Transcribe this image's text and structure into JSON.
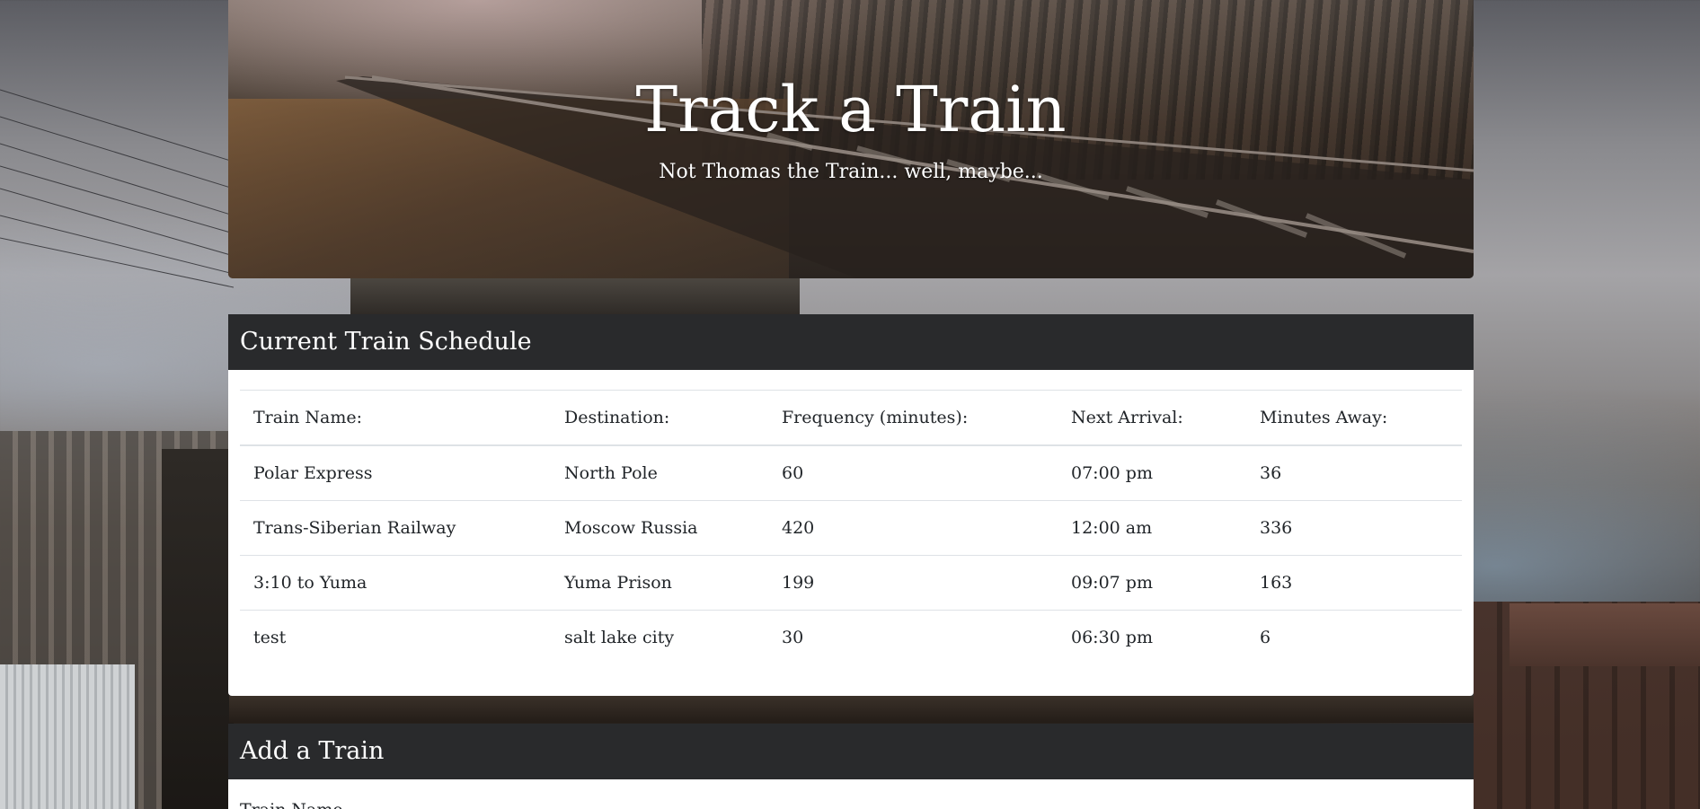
{
  "jumbotron": {
    "title": "Track a Train",
    "subtitle": "Not Thomas the Train... well, maybe..."
  },
  "schedule": {
    "header": "Current Train Schedule",
    "columns": [
      "Train Name:",
      "Destination:",
      "Frequency (minutes):",
      "Next Arrival:",
      "Minutes Away:"
    ],
    "rows": [
      {
        "name": "Polar Express",
        "destination": "North Pole",
        "frequency": "60",
        "next_arrival": "07:00 pm",
        "minutes_away": "36"
      },
      {
        "name": "Trans-Siberian Railway",
        "destination": "Moscow Russia",
        "frequency": "420",
        "next_arrival": "12:00 am",
        "minutes_away": "336"
      },
      {
        "name": "3:10 to Yuma",
        "destination": "Yuma Prison",
        "frequency": "199",
        "next_arrival": "09:07 pm",
        "minutes_away": "163"
      },
      {
        "name": "test",
        "destination": "salt lake city",
        "frequency": "30",
        "next_arrival": "06:30 pm",
        "minutes_away": "6"
      }
    ]
  },
  "add_train": {
    "header": "Add a Train",
    "first_field_label": "Train Name"
  },
  "colors": {
    "card_header_bg": "#292a2c",
    "card_bg": "#ffffff",
    "text": "#212529",
    "border": "#dee2e6"
  }
}
